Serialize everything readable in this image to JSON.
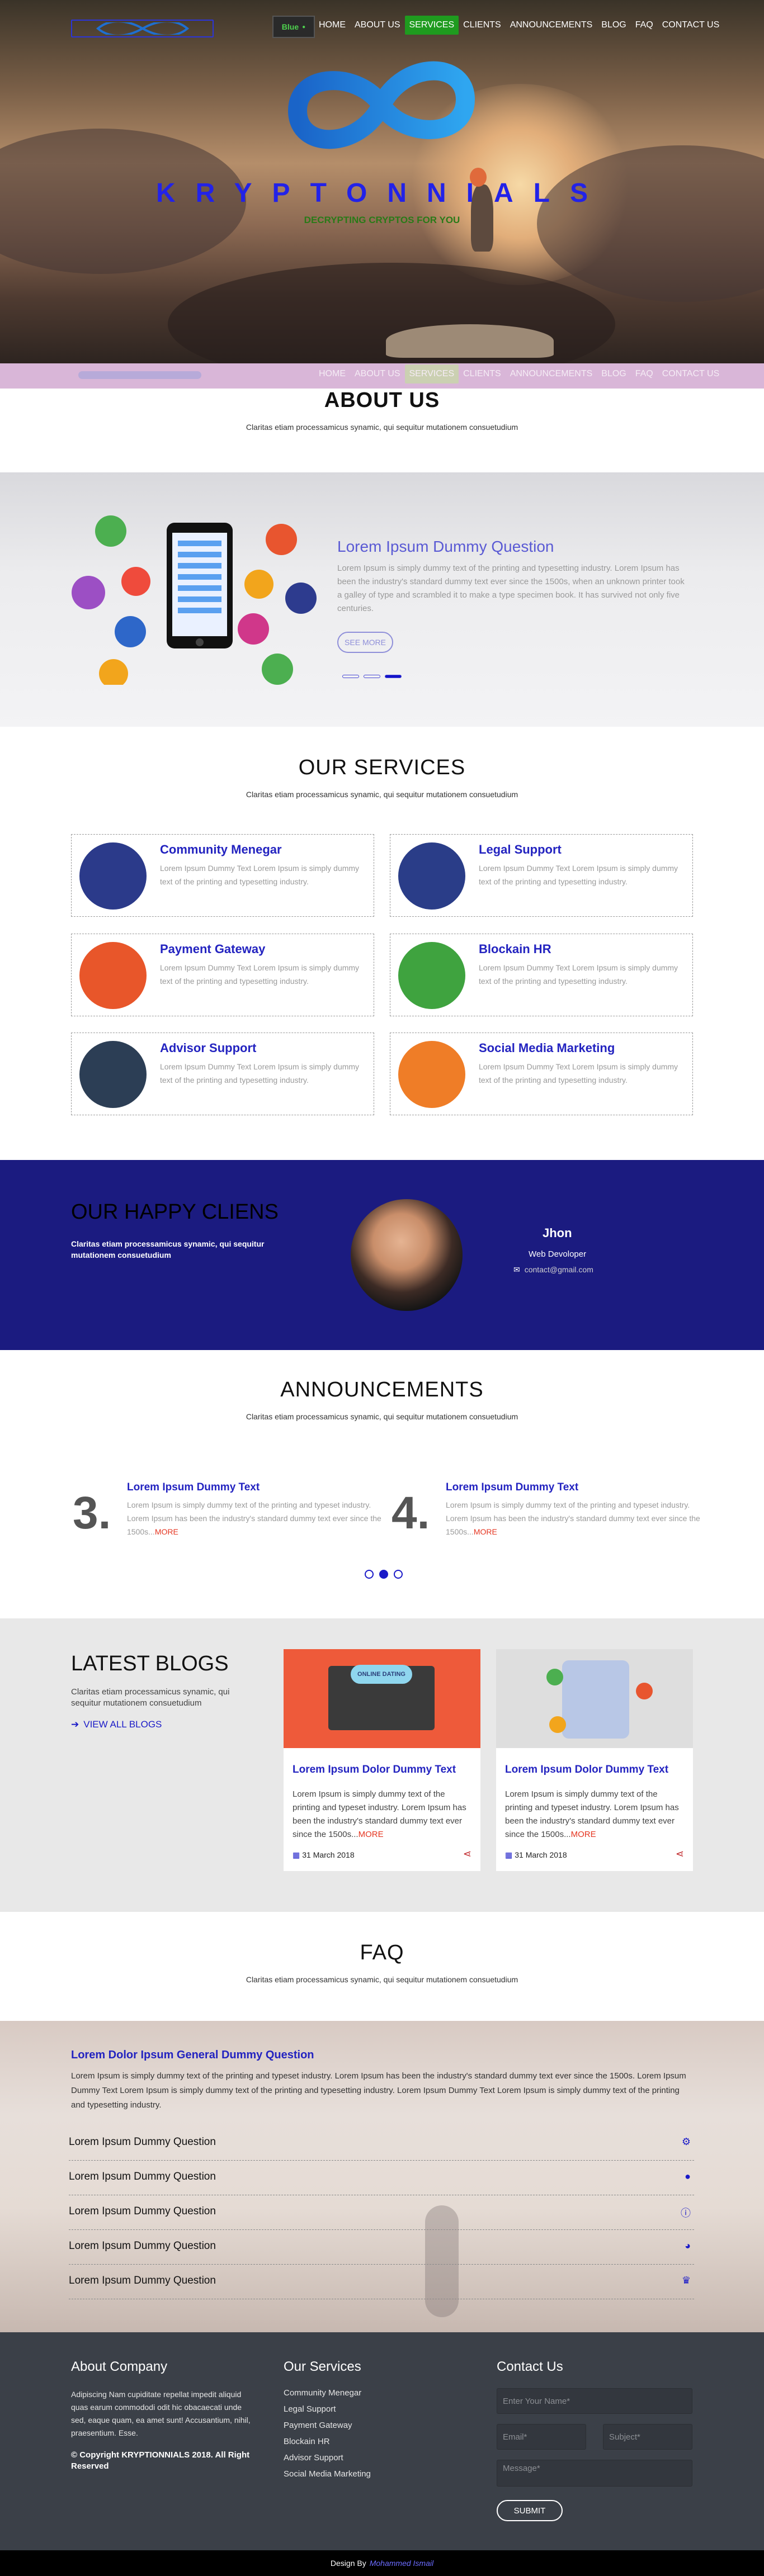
{
  "nav": [
    "HOME",
    "ABOUT US",
    "SERVICES",
    "CLIENTS",
    "ANNOUNCEMENTS",
    "BLOG",
    "FAQ",
    "CONTACT US"
  ],
  "brand_badge": "Blue",
  "hero": {
    "title": "KRYPTONNIALS",
    "tagline": "DECRYPTING CRYPTOS FOR YOU"
  },
  "about": {
    "title": "ABOUT US",
    "subtitle": "Claritas etiam processamicus synamic, qui sequitur mutationem consuetudium"
  },
  "slider": {
    "title": "Lorem Ipsum Dummy Question",
    "text": "Lorem Ipsum is simply dummy text of the printing and typesetting industry. Lorem Ipsum has been the industry's standard dummy text ever since the 1500s, when an unknown printer took a galley of type and scrambled it to make a type specimen book. It has survived not only five centuries.",
    "button": "SEE MORE"
  },
  "services": {
    "title": "OUR SERVICES",
    "subtitle": "Claritas etiam processamicus synamic, qui sequitur mutationem consuetudium",
    "items": [
      {
        "name": "Community Menegar",
        "text": "Lorem Ipsum Dummy Text Lorem Ipsum is simply dummy text of the printing and typesetting industry.",
        "color": "#2b3a8a"
      },
      {
        "name": "Legal Support",
        "text": "Lorem Ipsum Dummy Text Lorem Ipsum is simply dummy text of the printing and typesetting industry.",
        "color": "#2a3d88"
      },
      {
        "name": "Payment Gateway",
        "text": "Lorem Ipsum Dummy Text Lorem Ipsum is simply dummy text of the printing and typesetting industry.",
        "color": "#e8562a"
      },
      {
        "name": "Blockain HR",
        "text": "Lorem Ipsum Dummy Text Lorem Ipsum is simply dummy text of the printing and typesetting industry.",
        "color": "#3fa33f"
      },
      {
        "name": "Advisor Support",
        "text": "Lorem Ipsum Dummy Text Lorem Ipsum is simply dummy text of the printing and typesetting industry.",
        "color": "#2c3e55"
      },
      {
        "name": "Social Media Marketing",
        "text": "Lorem Ipsum Dummy Text Lorem Ipsum is simply dummy text of the printing and typesetting industry.",
        "color": "#ef7d27"
      }
    ]
  },
  "clients": {
    "title": "OUR HAPPY CLIENS",
    "subtitle": "Claritas etiam processamicus synamic, qui sequitur mutationem consuetudium",
    "name": "Jhon",
    "role": "Web Devoloper",
    "email": "contact@gmail.com"
  },
  "announcements": {
    "title": "ANNOUNCEMENTS",
    "subtitle": "Claritas etiam processamicus synamic, qui sequitur mutationem consuetudium",
    "items": [
      {
        "num": "3.",
        "title": "Lorem Ipsum Dummy Text",
        "text": "Lorem Ipsum is simply dummy text of the printing and typeset industry. Lorem Ipsum has been the industry's standard dummy text ever since the 1500s...",
        "more": "MORE"
      },
      {
        "num": "4.",
        "title": "Lorem Ipsum Dummy Text",
        "text": "Lorem Ipsum is simply dummy text of the printing and typeset industry. Lorem Ipsum has been the industry's standard dummy text ever since the 1500s...",
        "more": "MORE"
      }
    ]
  },
  "blogs": {
    "title": "LATEST BLOGS",
    "subtitle": "Claritas etiam processamicus synamic, qui sequitur mutationem consuetudium",
    "link": "VIEW ALL BLOGS",
    "cards": [
      {
        "title": "Lorem Ipsum Dolor Dummy Text",
        "text": "Lorem Ipsum is simply dummy text of the printing and typeset industry. Lorem Ipsum has been the industry's standard dummy text ever since the 1500s...",
        "more": "MORE",
        "date": "31 March 2018",
        "img_label": "ONLINE DATING"
      },
      {
        "title": "Lorem Ipsum Dolor Dummy Text",
        "text": "Lorem Ipsum is simply dummy text of the printing and typeset industry. Lorem Ipsum has been the industry's standard dummy text ever since the 1500s...",
        "more": "MORE",
        "date": "31 March 2018"
      }
    ]
  },
  "faq": {
    "title": "FAQ",
    "subtitle": "Claritas etiam processamicus synamic, qui sequitur mutationem consuetudium",
    "open_q": "Lorem Dolor Ipsum General Dummy Question",
    "open_a": "Lorem Ipsum is simply dummy text of the printing and typeset industry. Lorem Ipsum has been the industry's standard dummy text ever since the 1500s. Lorem Ipsum Dummy Text Lorem Ipsum is simply dummy text of the printing and typesetting industry. Lorem Ipsum Dummy Text Lorem Ipsum is simply dummy text of the printing and typesetting industry.",
    "questions": [
      "Lorem Ipsum Dummy Question",
      "Lorem Ipsum Dummy Question",
      "Lorem Ipsum Dummy Question",
      "Lorem Ipsum Dummy Question",
      "Lorem Ipsum Dummy Question"
    ]
  },
  "footer": {
    "about_title": "About Company",
    "about_text": "Adipiscing Nam cupiditate repellat impedit aliquid quas earum commododi odit hic obacaecati unde sed, eaque quam, ea amet sunt! Accusantium, nihil, praesentium. Esse.",
    "copyright": "© Copyright KRYPTIONNIALS 2018. All Right Reserved",
    "services_title": "Our Services",
    "services": [
      "Community Menegar",
      "Legal Support",
      "Payment Gateway",
      "Blockain HR",
      "Advisor Support",
      "Social Media Marketing"
    ],
    "contact_title": "Contact Us",
    "name_ph": "Enter Your Name*",
    "email_ph": "Email*",
    "subject_ph": "Subject*",
    "message_ph": "Message*",
    "submit": "SUBMIT"
  },
  "credit": {
    "prefix": "Design By",
    "author": "Mohammed Ismail"
  }
}
